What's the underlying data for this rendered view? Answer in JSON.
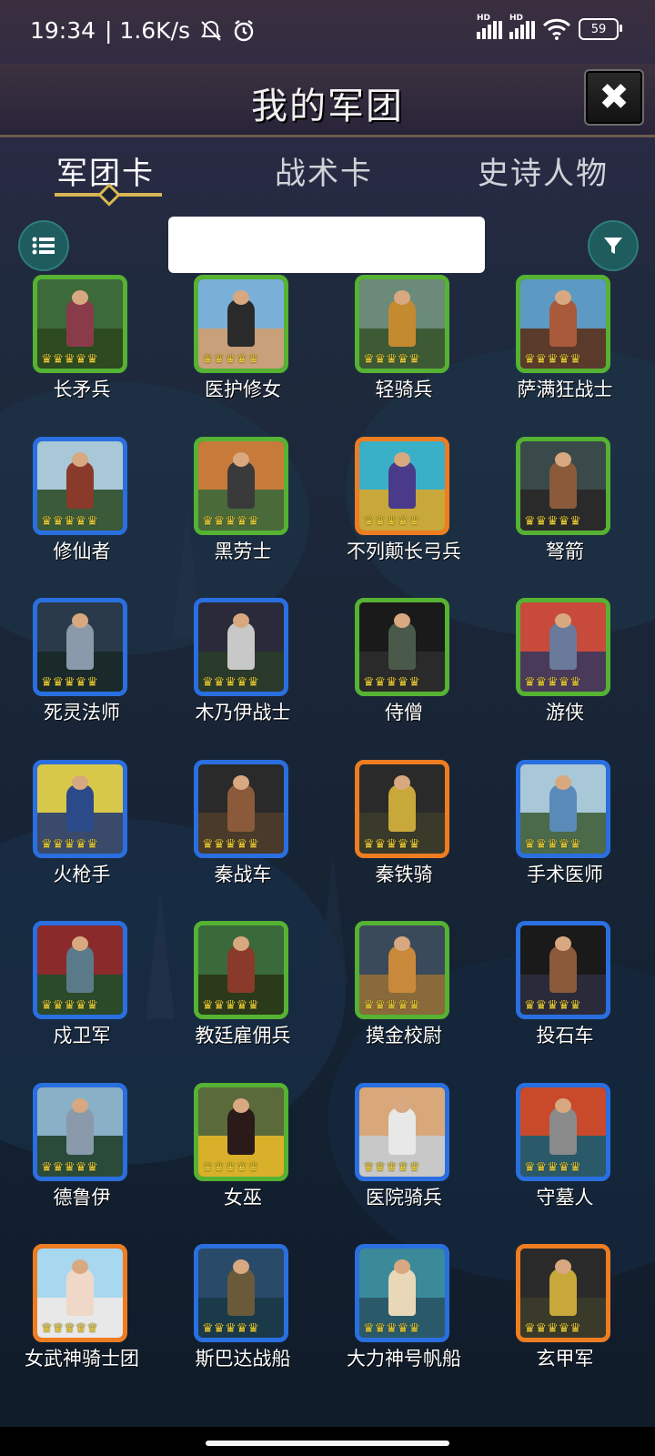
{
  "status_bar": {
    "time": "19:34",
    "speed": "| 1.6K/s",
    "battery": "59",
    "hd_label": "HD"
  },
  "header": {
    "title": "我的军团"
  },
  "tabs": [
    {
      "label": "军团卡",
      "active": true
    },
    {
      "label": "战术卡",
      "active": false
    },
    {
      "label": "史诗人物",
      "active": false
    }
  ],
  "search": {
    "placeholder": ""
  },
  "colors": {
    "rarity_green": "#55b233",
    "rarity_blue": "#2a6fe0",
    "rarity_orange": "#ee7d22",
    "accent_gold": "#d8b654",
    "button_teal": "#1f5c5e"
  },
  "cards": [
    {
      "name": "长矛兵",
      "rarity": "green",
      "icon": "spearman-portrait",
      "sky": "#3d6a3a",
      "ground": "#2d4a20",
      "fig": "#8a3b4a"
    },
    {
      "name": "医护修女",
      "rarity": "green",
      "icon": "nun-portrait",
      "sky": "#7ab0d8",
      "ground": "#c8a07a",
      "fig": "#2a2a2a"
    },
    {
      "name": "轻骑兵",
      "rarity": "green",
      "icon": "light-cavalry-portrait",
      "sky": "#6b8a7a",
      "ground": "#3e5a35",
      "fig": "#c48a30"
    },
    {
      "name": "萨满狂战士",
      "rarity": "green",
      "icon": "berserker-portrait",
      "sky": "#5c9ac4",
      "ground": "#5a3a2a",
      "fig": "#a85a3a"
    },
    {
      "name": "修仙者",
      "rarity": "blue",
      "icon": "cultivator-portrait",
      "sky": "#a8c8d8",
      "ground": "#3a5a3a",
      "fig": "#8a3a2a"
    },
    {
      "name": "黑劳士",
      "rarity": "green",
      "icon": "helot-portrait",
      "sky": "#c87a3a",
      "ground": "#4a6a3a",
      "fig": "#3a3a3a"
    },
    {
      "name": "不列颠长弓兵",
      "rarity": "orange",
      "icon": "longbowman-portrait",
      "sky": "#3ab0c8",
      "ground": "#c8a83a",
      "fig": "#4a3a8a"
    },
    {
      "name": "弩箭",
      "rarity": "green",
      "icon": "ballista-portrait",
      "sky": "#3a4a4a",
      "ground": "#2a2a2a",
      "fig": "#8a5a3a"
    },
    {
      "name": "死灵法师",
      "rarity": "blue",
      "icon": "necromancer-portrait",
      "sky": "#2a3a4a",
      "ground": "#1a2a2a",
      "fig": "#8a9aaa"
    },
    {
      "name": "木乃伊战士",
      "rarity": "blue",
      "icon": "mummy-warrior-portrait",
      "sky": "#2a2a3a",
      "ground": "#2a3a2a",
      "fig": "#c8c8c8"
    },
    {
      "name": "侍僧",
      "rarity": "green",
      "icon": "acolyte-portrait",
      "sky": "#1a1a1a",
      "ground": "#2a2a2a",
      "fig": "#4a5a4a"
    },
    {
      "name": "游侠",
      "rarity": "green",
      "icon": "ranger-portrait",
      "sky": "#c84a3a",
      "ground": "#4a3a5a",
      "fig": "#6a7a9a"
    },
    {
      "name": "火枪手",
      "rarity": "blue",
      "icon": "musketeer-portrait",
      "sky": "#d8c84a",
      "ground": "#3a4a6a",
      "fig": "#2a4a8a"
    },
    {
      "name": "秦战车",
      "rarity": "blue",
      "icon": "qin-chariot-portrait",
      "sky": "#2a2a2a",
      "ground": "#4a3a2a",
      "fig": "#8a5a3a"
    },
    {
      "name": "秦铁骑",
      "rarity": "orange",
      "icon": "qin-cavalry-portrait",
      "sky": "#2a2a2a",
      "ground": "#3a3a2a",
      "fig": "#c8a83a"
    },
    {
      "name": "手术医师",
      "rarity": "blue",
      "icon": "surgeon-portrait",
      "sky": "#a8c8d8",
      "ground": "#4a6a4a",
      "fig": "#5a8ab8"
    },
    {
      "name": "戍卫军",
      "rarity": "blue",
      "icon": "garrison-portrait",
      "sky": "#8a2a2a",
      "ground": "#2a4a2a",
      "fig": "#5a7a8a"
    },
    {
      "name": "教廷雇佣兵",
      "rarity": "green",
      "icon": "papal-mercenary-portrait",
      "sky": "#3a6a3a",
      "ground": "#2a3a1a",
      "fig": "#8a3a2a"
    },
    {
      "name": "摸金校尉",
      "rarity": "green",
      "icon": "tomb-raider-portrait",
      "sky": "#3a4a5a",
      "ground": "#8a6a3a",
      "fig": "#c88a3a"
    },
    {
      "name": "投石车",
      "rarity": "blue",
      "icon": "catapult-portrait",
      "sky": "#1a1a1a",
      "ground": "#2a2a3a",
      "fig": "#8a5a3a"
    },
    {
      "name": "德鲁伊",
      "rarity": "blue",
      "icon": "druid-portrait",
      "sky": "#8ab0c8",
      "ground": "#2a4a3a",
      "fig": "#8a9aaa"
    },
    {
      "name": "女巫",
      "rarity": "green",
      "icon": "witch-portrait",
      "sky": "#5a6a3a",
      "ground": "#d8b02a",
      "fig": "#2a1a1a"
    },
    {
      "name": "医院骑兵",
      "rarity": "blue",
      "icon": "hospitaller-portrait",
      "sky": "#d8a87a",
      "ground": "#c8c8c8",
      "fig": "#e8e8e8"
    },
    {
      "name": "守墓人",
      "rarity": "blue",
      "icon": "gravekeeper-portrait",
      "sky": "#c84a2a",
      "ground": "#2a5a6a",
      "fig": "#8a8a8a"
    },
    {
      "name": "女武神骑士团",
      "rarity": "orange",
      "icon": "valkyrie-portrait",
      "sky": "#a8d8f0",
      "ground": "#e8e8e8",
      "fig": "#f0d8c8"
    },
    {
      "name": "斯巴达战船",
      "rarity": "blue",
      "icon": "spartan-warship-portrait",
      "sky": "#2a4a6a",
      "ground": "#1a3a4a",
      "fig": "#6a5a3a"
    },
    {
      "name": "大力神号帆船",
      "rarity": "blue",
      "icon": "hercules-galleon-portrait",
      "sky": "#3a8a9a",
      "ground": "#2a5a6a",
      "fig": "#e8d8b8"
    },
    {
      "name": "玄甲军",
      "rarity": "orange",
      "icon": "black-armor-cavalry-portrait",
      "sky": "#2a2a2a",
      "ground": "#3a3a2a",
      "fig": "#c8a83a"
    }
  ]
}
